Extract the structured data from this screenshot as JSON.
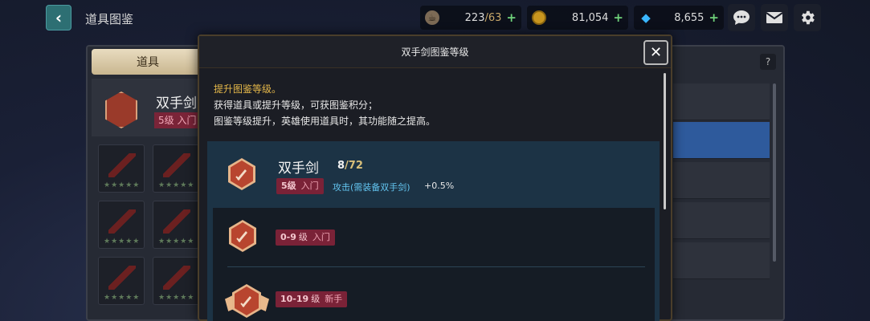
{
  "topbar": {
    "back_icon": "chevron-left-icon",
    "title": "道具图鉴",
    "stamina": {
      "icon": "cup-icon",
      "current": "223",
      "max": "63",
      "plus": "+"
    },
    "gold": {
      "icon": "coin-icon",
      "value": "81,054",
      "plus": "+"
    },
    "gems": {
      "icon": "diamond-icon",
      "value": "8,655",
      "plus": "+"
    },
    "buttons": [
      "chat-icon",
      "mail-icon",
      "gear-icon"
    ]
  },
  "background": {
    "active_tab": "道具",
    "item_name": "双手剑",
    "item_badge": "5级 入门",
    "help_label": "?"
  },
  "modal": {
    "title": "双手剑图鉴等级",
    "close_icon": "close-icon",
    "description": [
      "提升图鉴等级。",
      "获得道具或提升等级，可获图鉴积分；",
      "图鉴等级提升，英雄使用道具时，其功能随之提高。"
    ],
    "item": {
      "name": "双手剑",
      "progress_current": "8",
      "progress_max": "/72",
      "level": "5级",
      "rank": "入门",
      "effect": "攻击(需装备双手剑)",
      "bonus": "+0.5%"
    },
    "tiers": [
      {
        "range": "0-9",
        "unit": "级",
        "rank": "入门"
      },
      {
        "range": "10-19",
        "unit": "级",
        "rank": "新手"
      }
    ]
  },
  "colors": {
    "accent_gold": "#e5b84a",
    "effect_blue": "#62c3ee",
    "badge_red": "#7a2237",
    "card_bg": "#1c3345"
  }
}
